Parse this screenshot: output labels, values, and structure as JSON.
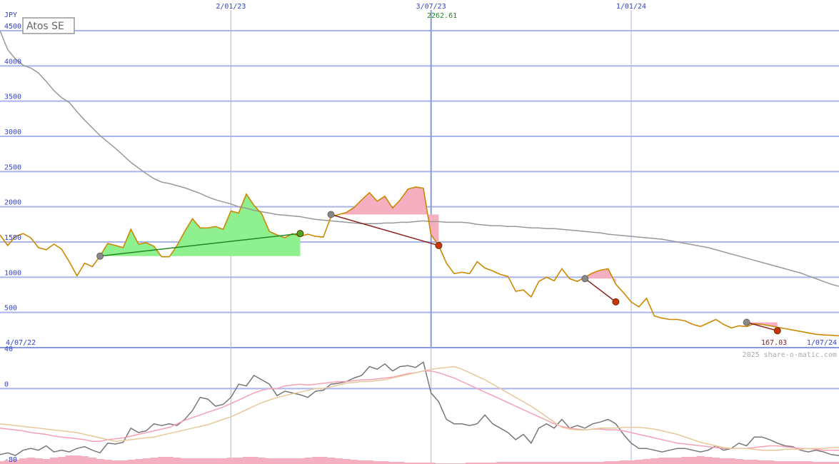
{
  "chart_data": {
    "type": "line",
    "title": "Atos SE",
    "currency": "JPY",
    "price_panel": {
      "ylim": [
        0,
        4500
      ],
      "yticks": [
        "4500",
        "4000",
        "3500",
        "3000",
        "2500",
        "2000",
        "1500",
        "1000",
        "500"
      ],
      "ytick_values": [
        4500,
        4000,
        3500,
        3000,
        2500,
        2000,
        1500,
        1000,
        500
      ],
      "date_start": "4/07/22",
      "date_end": "1/07/24",
      "x_gridlines": [
        {
          "label": "2/01/23",
          "week": 30
        },
        {
          "label": "3/07/23",
          "week": 56
        },
        {
          "label": "1/01/24",
          "week": 82
        }
      ],
      "peak_label": "2262.61",
      "peak_week": 56,
      "last_label": "167.03",
      "series": [
        {
          "role": "price",
          "color": "#cc8800",
          "values": [
            1600,
            1450,
            1580,
            1620,
            1560,
            1420,
            1390,
            1470,
            1400,
            1220,
            1020,
            1200,
            1150,
            1300,
            1480,
            1450,
            1420,
            1680,
            1470,
            1490,
            1440,
            1290,
            1290,
            1450,
            1650,
            1830,
            1700,
            1700,
            1720,
            1680,
            1940,
            1910,
            2180,
            2020,
            1900,
            1650,
            1600,
            1560,
            1620,
            1580,
            1610,
            1580,
            1570,
            1860,
            1890,
            1920,
            1990,
            2100,
            2200,
            2080,
            2150,
            1980,
            2100,
            2250,
            2280,
            2263,
            1600,
            1450,
            1200,
            1050,
            1070,
            1050,
            1220,
            1130,
            1090,
            1040,
            1010,
            800,
            820,
            720,
            940,
            1000,
            950,
            1120,
            980,
            940,
            1000,
            1060,
            1100,
            1120,
            900,
            780,
            650,
            580,
            700,
            450,
            420,
            400,
            400,
            380,
            330,
            300,
            350,
            400,
            330,
            280,
            310,
            300,
            340,
            330,
            310,
            290,
            270,
            250,
            230,
            210,
            190,
            180,
            175,
            167
          ]
        },
        {
          "role": "long-term average",
          "color": "#999999",
          "values": [
            4500,
            4230,
            4100,
            4010,
            3970,
            3900,
            3780,
            3650,
            3550,
            3480,
            3350,
            3230,
            3120,
            3010,
            2920,
            2830,
            2730,
            2630,
            2550,
            2470,
            2400,
            2350,
            2330,
            2300,
            2270,
            2230,
            2190,
            2140,
            2100,
            2070,
            2040,
            2000,
            1980,
            1950,
            1930,
            1910,
            1890,
            1880,
            1870,
            1860,
            1840,
            1820,
            1810,
            1800,
            1790,
            1780,
            1770,
            1760,
            1760,
            1760,
            1770,
            1770,
            1780,
            1780,
            1790,
            1800,
            1790,
            1790,
            1780,
            1780,
            1780,
            1770,
            1750,
            1740,
            1730,
            1730,
            1720,
            1720,
            1710,
            1700,
            1700,
            1690,
            1690,
            1680,
            1670,
            1660,
            1650,
            1640,
            1630,
            1610,
            1600,
            1590,
            1580,
            1570,
            1560,
            1550,
            1540,
            1520,
            1500,
            1480,
            1460,
            1440,
            1420,
            1390,
            1360,
            1330,
            1300,
            1270,
            1240,
            1210,
            1180,
            1150,
            1120,
            1090,
            1060,
            1020,
            980,
            940,
            900,
            870
          ]
        }
      ],
      "trades": [
        {
          "from_week": 13,
          "from_value": 1300,
          "to_week": 39,
          "to_value": 1620,
          "result": "gain",
          "line_color": "#228822"
        },
        {
          "from_week": 43,
          "from_value": 1890,
          "to_week": 57,
          "to_value": 1450,
          "result": "loss",
          "line_color": "#882222"
        },
        {
          "from_week": 76,
          "from_value": 980,
          "to_week": 80,
          "to_value": 650,
          "result": "loss",
          "line_color": "#882222"
        },
        {
          "from_week": 97,
          "from_value": 360,
          "to_week": 101,
          "to_value": 240,
          "result": "loss",
          "line_color": "#882222"
        }
      ],
      "gain_fill_color": "#8ef08e",
      "loss_fill_color": "#f4b0c0"
    },
    "oscillator_panel": {
      "ylim": [
        -80,
        40
      ],
      "yticks": [
        "40",
        "0",
        "-80"
      ],
      "ytick_values": [
        40,
        0,
        -80
      ],
      "series": [
        {
          "role": "momentum",
          "color": "#777777",
          "values": [
            -75,
            -73,
            -76,
            -70,
            -68,
            -70,
            -65,
            -72,
            -70,
            -72,
            -68,
            -66,
            -70,
            -73,
            -62,
            -63,
            -61,
            -45,
            -50,
            -48,
            -40,
            -42,
            -40,
            -42,
            -35,
            -25,
            -10,
            -12,
            -20,
            -18,
            -10,
            5,
            3,
            15,
            10,
            5,
            -8,
            -3,
            -5,
            -7,
            -10,
            -3,
            -2,
            5,
            6,
            8,
            12,
            15,
            25,
            22,
            28,
            20,
            25,
            26,
            24,
            30,
            -5,
            -15,
            -35,
            -40,
            -40,
            -42,
            -40,
            -30,
            -40,
            -45,
            -50,
            -58,
            -52,
            -62,
            -45,
            -40,
            -45,
            -35,
            -45,
            -42,
            -45,
            -40,
            -38,
            -35,
            -40,
            -52,
            -62,
            -68,
            -68,
            -70,
            -72,
            -70,
            -68,
            -68,
            -70,
            -72,
            -70,
            -65,
            -70,
            -68,
            -62,
            -65,
            -55,
            -55,
            -58,
            -62,
            -65,
            -66,
            -70,
            -72,
            -70,
            -72,
            -75,
            -76
          ]
        },
        {
          "role": "fast average",
          "color": "#f4a0b8",
          "values": [
            -45,
            -46,
            -47,
            -48,
            -50,
            -51,
            -52,
            -54,
            -55,
            -56,
            -57,
            -58,
            -60,
            -60,
            -58,
            -57,
            -56,
            -54,
            -52,
            -50,
            -48,
            -46,
            -44,
            -40,
            -36,
            -33,
            -30,
            -27,
            -24,
            -21,
            -17,
            -13,
            -9,
            -5,
            -2,
            0,
            0,
            3,
            4,
            5,
            4,
            5,
            6,
            7,
            8,
            8,
            9,
            10,
            10,
            11,
            12,
            13,
            15,
            17,
            18,
            20,
            20,
            18,
            15,
            12,
            8,
            4,
            0,
            -4,
            -8,
            -12,
            -16,
            -20,
            -24,
            -28,
            -32,
            -36,
            -40,
            -43,
            -45,
            -46,
            -47,
            -46,
            -46,
            -47,
            -47,
            -48,
            -50,
            -52,
            -54,
            -56,
            -58,
            -60,
            -62,
            -63,
            -64,
            -65,
            -66,
            -67,
            -68,
            -68,
            -68,
            -68,
            -67,
            -66,
            -65,
            -65,
            -66,
            -67,
            -68,
            -68,
            -69,
            -70,
            -70,
            -70
          ]
        },
        {
          "role": "slow average",
          "color": "#e6c89a",
          "values": [
            -40,
            -41,
            -42,
            -43,
            -44,
            -45,
            -46,
            -47,
            -48,
            -49,
            -50,
            -52,
            -54,
            -56,
            -58,
            -60,
            -59,
            -58,
            -57,
            -56,
            -55,
            -53,
            -51,
            -49,
            -47,
            -45,
            -43,
            -41,
            -38,
            -35,
            -32,
            -28,
            -24,
            -20,
            -16,
            -13,
            -10,
            -8,
            -6,
            -4,
            -2,
            0,
            0,
            2,
            4,
            6,
            7,
            8,
            8,
            9,
            10,
            12,
            14,
            16,
            18,
            20,
            22,
            23,
            24,
            25,
            22,
            18,
            14,
            10,
            5,
            0,
            -5,
            -10,
            -15,
            -20,
            -26,
            -32,
            -38,
            -44,
            -46,
            -47,
            -47,
            -46,
            -45,
            -45,
            -45,
            -44,
            -44,
            -44,
            -45,
            -46,
            -48,
            -50,
            -52,
            -55,
            -58,
            -61,
            -63,
            -65,
            -67,
            -68,
            -68,
            -68,
            -69,
            -70,
            -70,
            -70,
            -69,
            -69,
            -69,
            -68,
            -68,
            -68,
            -67,
            -67
          ]
        }
      ],
      "volume_color": "#f4b0c0",
      "volume_values": [
        4,
        5,
        6,
        8,
        9,
        8,
        7,
        9,
        10,
        12,
        12,
        11,
        9,
        7,
        6,
        5,
        5,
        6,
        7,
        8,
        9,
        10,
        10,
        9,
        8,
        8,
        8,
        8,
        8,
        8,
        9,
        9,
        10,
        10,
        9,
        8,
        8,
        8,
        8,
        8,
        9,
        10,
        10,
        9,
        8,
        7,
        6,
        5,
        5,
        4,
        4,
        3,
        3,
        2,
        2,
        2,
        2,
        1,
        1,
        1,
        1,
        2,
        2,
        2,
        2,
        3,
        3,
        3,
        3,
        3,
        3,
        3,
        3,
        3,
        3,
        3,
        3,
        3,
        3,
        4,
        4,
        5,
        5,
        6,
        7,
        8,
        9,
        9,
        9,
        10,
        10,
        11,
        10,
        9,
        8,
        8,
        7,
        6,
        6,
        5,
        5,
        4,
        4,
        4,
        4,
        4,
        3,
        3,
        3,
        3
      ]
    },
    "credit": "2025 share-o-matic.com"
  }
}
